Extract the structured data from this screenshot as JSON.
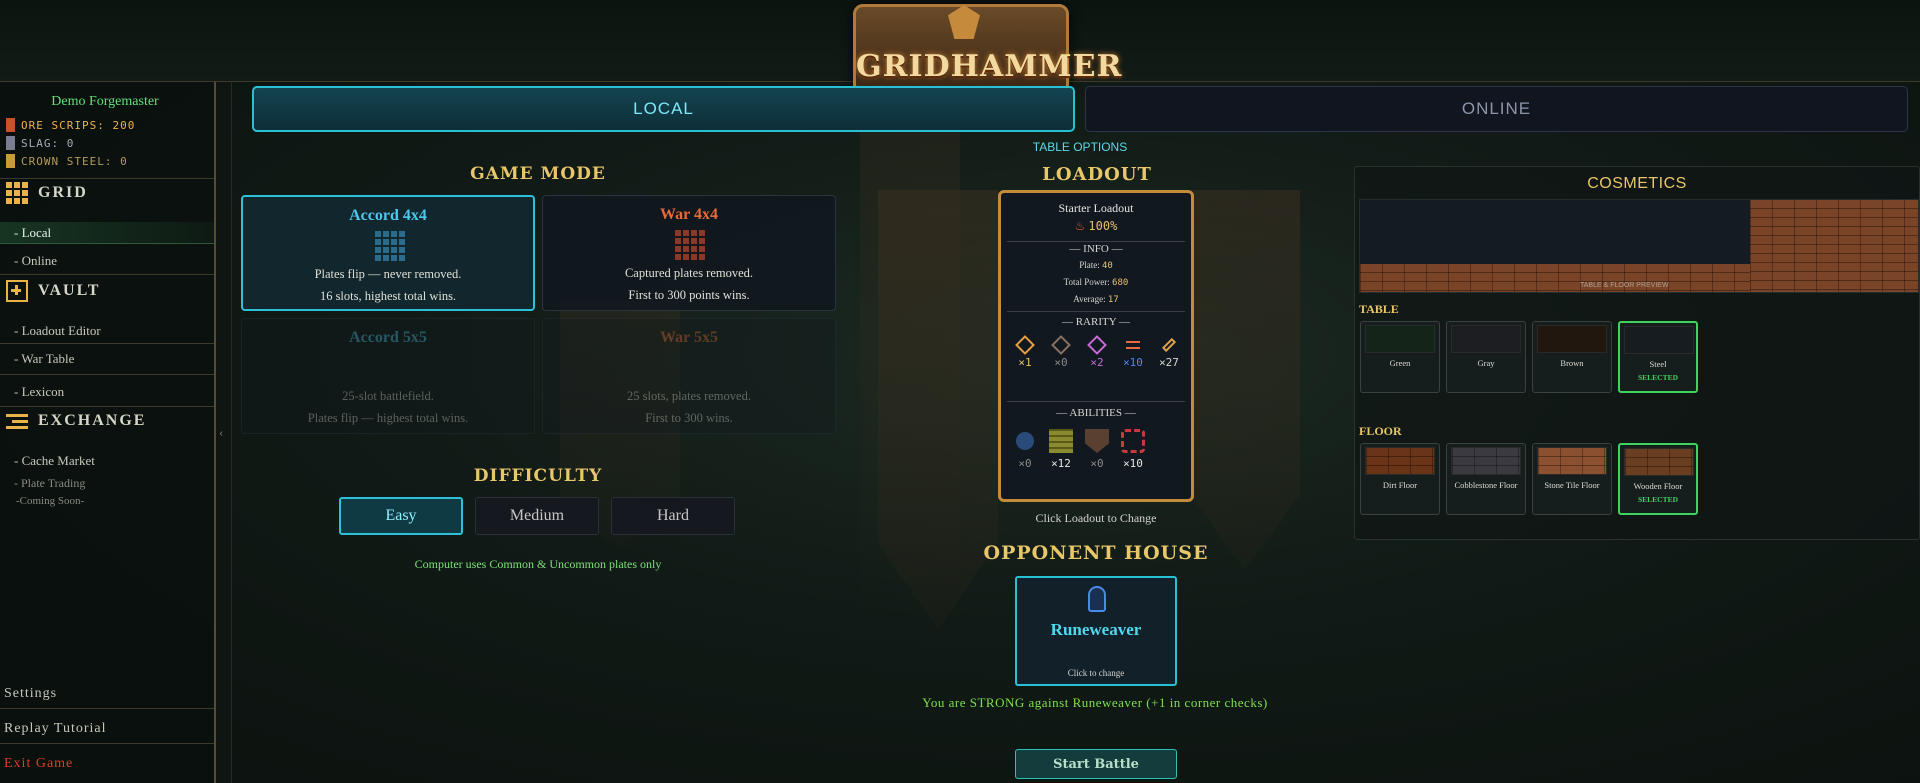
{
  "logo": {
    "text": "GRIDHAMMER"
  },
  "profile": {
    "name": "Demo Forgemaster"
  },
  "resources": [
    {
      "label": "ORE SCRIPS: 200",
      "color": "#f0b04a",
      "swatch": "#c8502a"
    },
    {
      "label": "SLAG: 0",
      "color": "#a8aab8",
      "swatch": "#7a7e92"
    },
    {
      "label": "CROWN STEEL: 0",
      "color": "#b89a58",
      "swatch": "#c89a38"
    }
  ],
  "nav": {
    "grid": {
      "label": "Grid",
      "icon": "grid-icon",
      "items": [
        "- Local",
        "- Online"
      ]
    },
    "vault": {
      "label": "Vault",
      "icon": "vault-icon",
      "items": [
        "- Loadout Editor",
        "- War Table",
        "- Lexicon"
      ]
    },
    "exchange": {
      "label": "Exchange",
      "icon": "exchange-icon",
      "items": [
        "- Cache Market",
        "- Plate Trading",
        "-Coming Soon-"
      ]
    },
    "footer": {
      "settings": "Settings",
      "replay": "Replay Tutorial",
      "exit": "Exit Game"
    },
    "collapse": "‹"
  },
  "tabs": {
    "local": "LOCAL",
    "online": "ONLINE"
  },
  "game_mode": {
    "title": "GAME MODE",
    "cards": [
      {
        "title": "Accord 4x4",
        "line1": "Plates flip — never removed.",
        "line2": "16 slots, highest total wins.",
        "color": "#4fc8ee",
        "grid": "#2a6c8c"
      },
      {
        "title": "War 4x4",
        "line1": "Captured plates removed.",
        "line2": "First to 300 points wins.",
        "color": "#e86a3a",
        "grid": "#8a3a24"
      },
      {
        "title": "Accord 5x5",
        "line1": "25-slot battlefield.",
        "line2": "Plates flip — highest total wins.",
        "color": "#4fc8ee",
        "grid": "#2a6c8c"
      },
      {
        "title": "War 5x5",
        "line1": "25 slots, plates removed.",
        "line2": "First to 300 wins.",
        "color": "#e86a3a",
        "grid": "#8a3a24"
      }
    ]
  },
  "difficulty": {
    "title": "DIFFICULTY",
    "options": [
      "Easy",
      "Medium",
      "Hard"
    ],
    "selected": "Easy",
    "note": "Computer uses Common & Uncommon plates only"
  },
  "loadout": {
    "table_options": "TABLE OPTIONS",
    "title": "LOADOUT",
    "name": "Starter Loadout",
    "percent": "100%",
    "info_label": "— INFO —",
    "plate_label": "Plate:",
    "plate_value": "40",
    "power_label": "Total Power:",
    "power_value": "680",
    "avg_label": "Average:",
    "avg_value": "17",
    "rarity_label": "— RARITY —",
    "rarity": [
      {
        "count": "×1",
        "color": "#e8a040"
      },
      {
        "count": "×0",
        "color": "#8a7060"
      },
      {
        "count": "×2",
        "color": "#c86ad8"
      },
      {
        "count": "×10",
        "color": "#4a8ae8"
      },
      {
        "count": "×27",
        "color": "#d8a048"
      }
    ],
    "abilities_label": "— ABILITIES —",
    "abilities": [
      {
        "count": "×0",
        "icon": "shield-orb-icon",
        "color": "#2a4a7a"
      },
      {
        "count": "×12",
        "icon": "tower-icon",
        "color": "#8a8a30"
      },
      {
        "count": "×0",
        "icon": "crest-icon",
        "color": "#5a4030"
      },
      {
        "count": "×10",
        "icon": "spiral-icon",
        "color": "#c83a3a"
      }
    ],
    "hint": "Click Loadout to Change"
  },
  "opponent": {
    "title": "OPPONENT HOUSE",
    "name": "Runeweaver",
    "hint": "Click to change",
    "status": "You are STRONG against Runeweaver (+1 in corner checks)"
  },
  "start_button": "Start Battle",
  "cosmetics": {
    "title": "COSMETICS",
    "preview_label": "TABLE & FLOOR PREVIEW",
    "table_label": "TABLE",
    "tables": [
      {
        "name": "Green",
        "color": "#142418",
        "selected": false
      },
      {
        "name": "Gray",
        "color": "#1c1e22",
        "selected": false
      },
      {
        "name": "Brown",
        "color": "#22170e",
        "selected": false
      },
      {
        "name": "Steel",
        "color": "#161c20",
        "selected": true
      }
    ],
    "floor_label": "FLOOR",
    "floors": [
      {
        "name": "Dirt Floor",
        "color": "#6a3418",
        "selected": false
      },
      {
        "name": "Cobblestone Floor",
        "color": "#3a3a40",
        "selected": false
      },
      {
        "name": "Stone Tile Floor",
        "color": "#8a5030",
        "selected": false
      },
      {
        "name": "Wooden Floor",
        "color": "#6a3e20",
        "selected": true
      }
    ],
    "selected_text": "SELECTED"
  }
}
